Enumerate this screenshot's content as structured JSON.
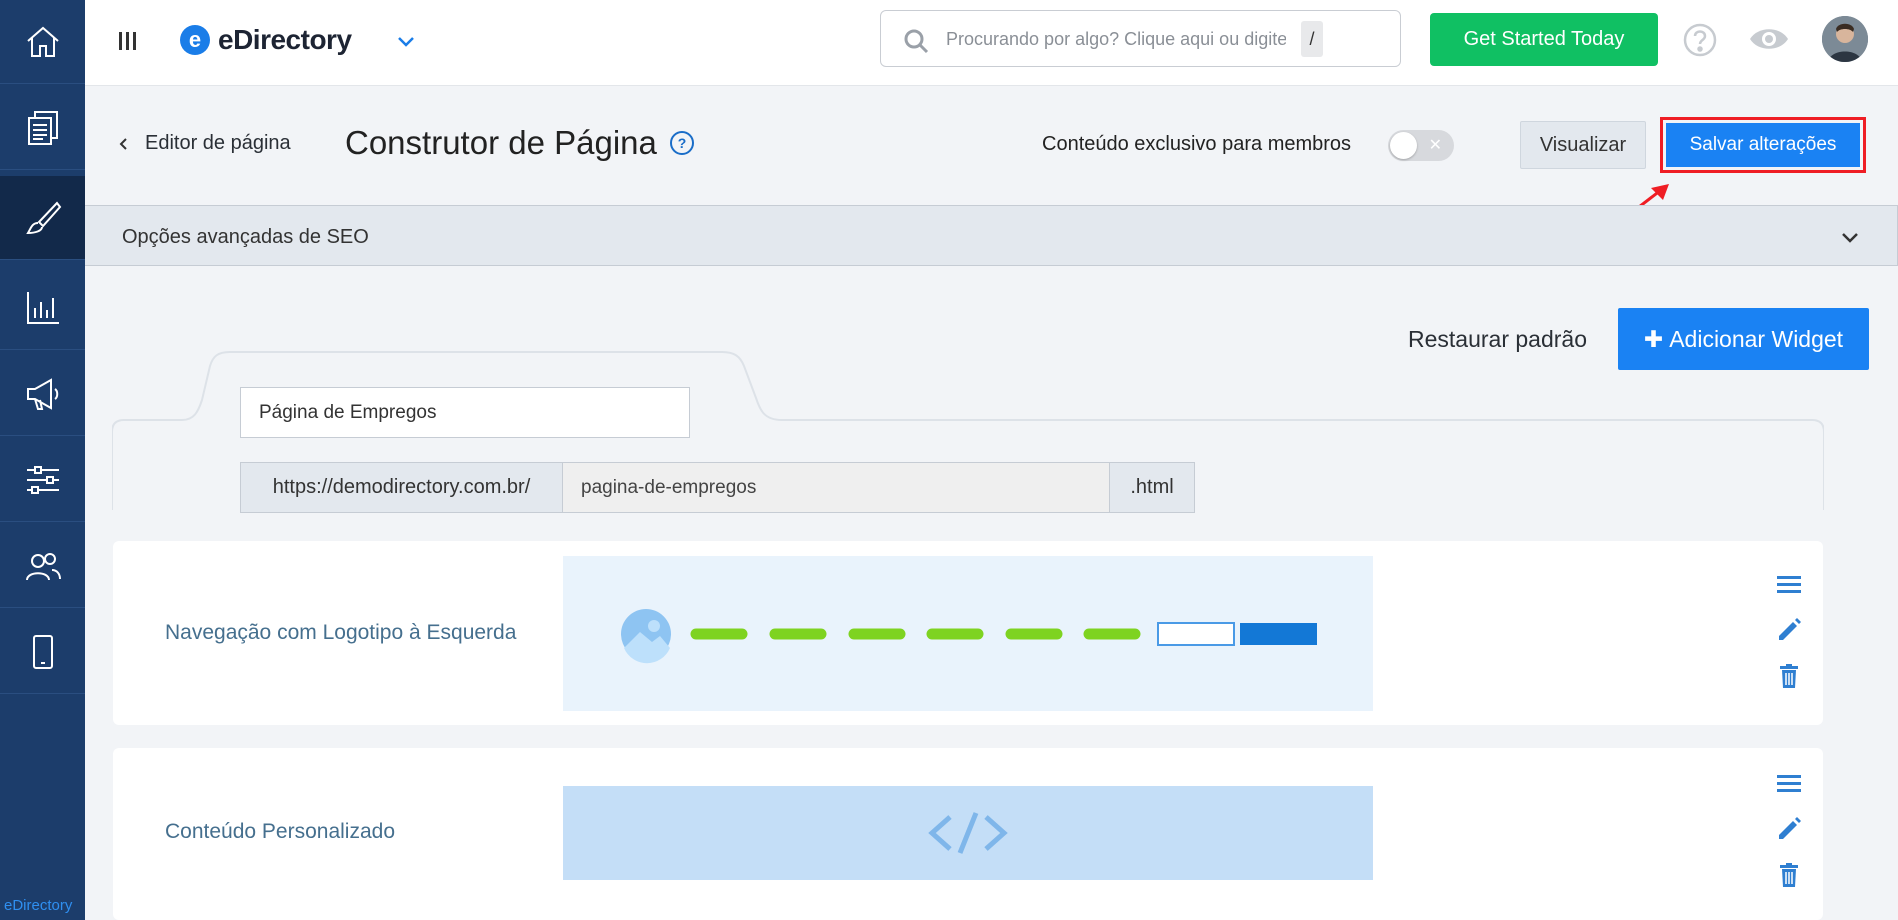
{
  "sidebar": {
    "brand": "eDirectory",
    "items": [
      {
        "name": "home",
        "icon": "home-icon"
      },
      {
        "name": "content",
        "icon": "documents-icon"
      },
      {
        "name": "design",
        "icon": "brush-icon",
        "active": true
      },
      {
        "name": "reports",
        "icon": "bar-chart-icon"
      },
      {
        "name": "promote",
        "icon": "megaphone-icon"
      },
      {
        "name": "settings",
        "icon": "sliders-icon"
      },
      {
        "name": "users",
        "icon": "users-icon"
      },
      {
        "name": "mobile",
        "icon": "mobile-icon"
      }
    ]
  },
  "header": {
    "logo_text": "eDirectory",
    "logo_letter": "e",
    "search_placeholder": "Procurando por algo? Clique aqui ou digite",
    "search_shortcut": "/",
    "cta_label": "Get Started Today"
  },
  "toolbar": {
    "back_label": "Editor de página",
    "title": "Construtor de Página",
    "help_glyph": "?",
    "members_label": "Conteúdo exclusivo para membros",
    "members_toggle": false,
    "preview_label": "Visualizar",
    "save_label": "Salvar alterações"
  },
  "seo": {
    "label": "Opções avançadas de SEO"
  },
  "widgets_toolbar": {
    "restore_label": "Restaurar padrão",
    "add_label": "Adicionar Widget"
  },
  "page_form": {
    "name_value": "Página de Empregos",
    "url_prefix": "https://demodirectory.com.br/",
    "url_slug": "pagina-de-empregos",
    "url_suffix": ".html"
  },
  "widgets": [
    {
      "label": "Navegação com Logotipo à Esquerda",
      "preview": "navigation"
    },
    {
      "label": "Conteúdo Personalizado",
      "preview": "custom-code"
    }
  ],
  "colors": {
    "sidebar": "#1c3d6b",
    "primary": "#1a82f3",
    "cta": "#10c063",
    "highlight": "#ef1d24",
    "nav_bars": "#7ed321"
  }
}
